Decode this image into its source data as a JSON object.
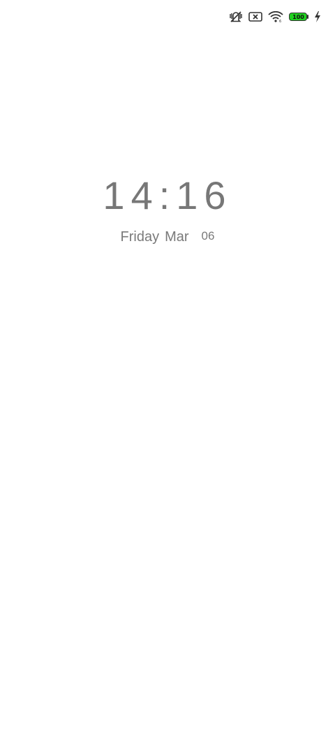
{
  "status_bar": {
    "icons": [
      "vibrate-mute-icon",
      "no-sim-icon",
      "wifi-icon",
      "battery-icon",
      "charging-bolt-icon"
    ],
    "battery_level": "100",
    "battery_color": "#1fd11f"
  },
  "lock_screen": {
    "time": "14:16",
    "day": "Friday",
    "month": "Mar",
    "date": "06"
  }
}
